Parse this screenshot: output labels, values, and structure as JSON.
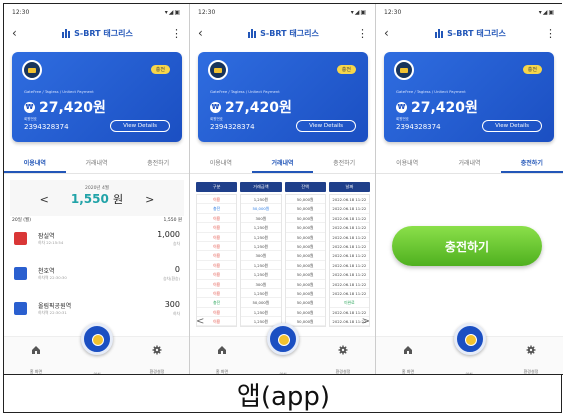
{
  "app": {
    "title": "S-BRT 태그리스"
  },
  "screens": [
    {
      "time": "12:30",
      "card": {
        "badge": "충전",
        "subtitle": "GateFree / Tagless / Unitect Payment",
        "amount": "27,420원",
        "number_label": "회원번호",
        "number": "2394328374",
        "view_details": "View Details"
      },
      "tabs": [
        "이용내역",
        "거래내역",
        "충전하기"
      ],
      "active_tab": 0
    },
    {
      "time": "12:30",
      "card": {
        "badge": "충전",
        "subtitle": "GateFree / Tagless / Unitect Payment",
        "amount": "27,420원",
        "number_label": "회원번호",
        "number": "2394328374",
        "view_details": "View Details"
      },
      "tabs": [
        "이용내역",
        "거래내역",
        "충전하기"
      ],
      "active_tab": 1
    },
    {
      "time": "12:30",
      "card": {
        "badge": "충전",
        "subtitle": "GateFree / Tagless / Unitect Payment",
        "amount": "27,420원",
        "number_label": "회원번호",
        "number": "2394328374",
        "view_details": "View Details"
      },
      "tabs": [
        "이용내역",
        "거래내역",
        "충전하기"
      ],
      "active_tab": 2
    }
  ],
  "usage": {
    "month_label": "2020년 4월",
    "prev": "<",
    "next": ">",
    "month_value": "1,550",
    "month_unit": "원",
    "day_label": "20일 (월)",
    "day_total": "1,550 원",
    "trips": [
      {
        "name": "잠실역",
        "time": "하차 22:15:54",
        "amount": "1,000",
        "sub": "승차",
        "color": "#d93636"
      },
      {
        "name": "천호역",
        "time": "하차역 22:30:30",
        "amount": "0",
        "sub": "승차(환승)",
        "color": "#2a5fcf"
      },
      {
        "name": "올림픽공원역",
        "time": "하차역 22:30:31",
        "amount": "300",
        "sub": "하차",
        "color": "#2a5fcf"
      }
    ]
  },
  "transactions": {
    "headers": [
      "구분",
      "거래금액",
      "잔액",
      "날짜"
    ],
    "rows": [
      [
        "이용",
        "1,250원",
        "50,000원",
        "2022.06.18 11:22",
        "red"
      ],
      [
        "충전",
        "50,000원",
        "50,000원",
        "2022.06.18 11:22",
        "blue"
      ],
      [
        "이용",
        "300원",
        "50,000원",
        "2022.06.18 11:22",
        "red"
      ],
      [
        "이용",
        "1,250원",
        "50,000원",
        "2022.06.18 11:22",
        "red"
      ],
      [
        "이용",
        "1,250원",
        "50,000원",
        "2022.06.18 11:22",
        "red"
      ],
      [
        "이용",
        "1,250원",
        "50,000원",
        "2022.06.18 11:22",
        "red"
      ],
      [
        "이용",
        "300원",
        "50,000원",
        "2022.06.18 11:22",
        "red"
      ],
      [
        "이용",
        "1,250원",
        "50,000원",
        "2022.06.18 11:22",
        "red"
      ],
      [
        "이용",
        "1,250원",
        "50,000원",
        "2022.06.18 11:22",
        "red"
      ],
      [
        "이용",
        "300원",
        "50,000원",
        "2022.06.18 11:22",
        "red"
      ],
      [
        "이용",
        "1,250원",
        "50,000원",
        "2022.06.18 11:22",
        "red"
      ],
      [
        "충전",
        "50,000원",
        "50,000원",
        "미완료",
        "green"
      ],
      [
        "이용",
        "1,250원",
        "50,000원",
        "2022.06.18 11:22",
        "red"
      ],
      [
        "이용",
        "1,250원",
        "50,000원",
        "2022.06.18 11:22",
        "red"
      ]
    ],
    "prev": "<",
    "next": ">"
  },
  "charge": {
    "button": "충전하기"
  },
  "nav": {
    "home": "홈 화면",
    "location": "위치",
    "settings": "환경설정"
  },
  "caption": "앱(app)",
  "icons": {
    "card_icon": "bus-card-icon",
    "home": "home-icon",
    "settings": "gear-icon",
    "fab": "tag-icon"
  },
  "colors": {
    "primary": "#2256b8",
    "card": "#2f6de0",
    "accent_teal": "#21a3a8",
    "charge_green": "#4fb01f"
  }
}
